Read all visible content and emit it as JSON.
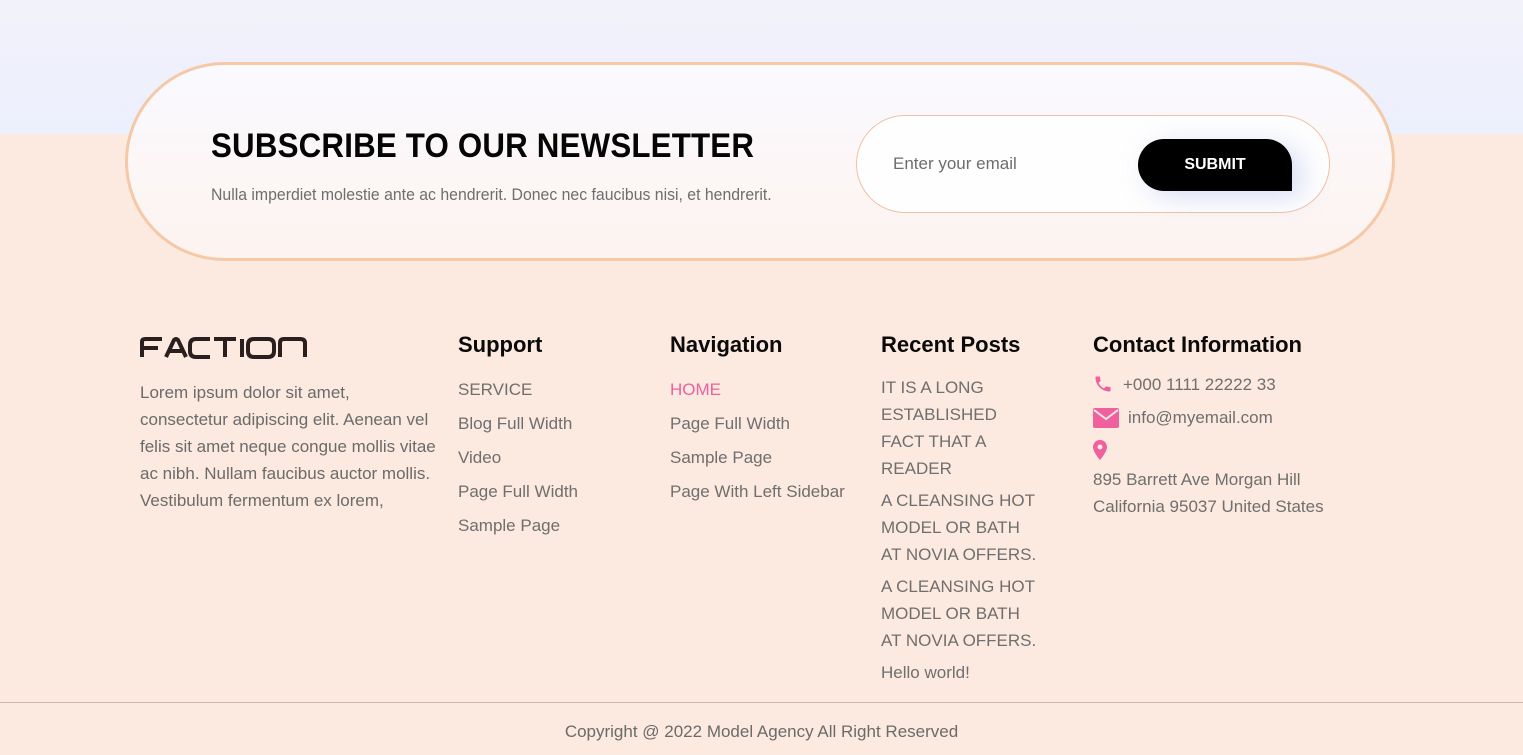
{
  "newsletter": {
    "title": "SUBSCRIBE TO OUR NEWSLETTER",
    "description": "Nulla imperdiet molestie ante ac hendrerit. Donec nec faucibus nisi, et hendrerit.",
    "email_placeholder": "Enter your email",
    "submit_label": "SUBMIT"
  },
  "brand": {
    "logo_text": "FACTION",
    "about": "Lorem ipsum dolor sit amet, consectetur adipiscing elit. Aenean vel felis sit amet neque congue mollis vitae ac nibh. Nullam faucibus auctor mollis. Vestibulum fermentum ex lorem,"
  },
  "support": {
    "heading": "Support",
    "items": [
      "SERVICE",
      "Blog Full Width",
      "Video",
      "Page Full Width",
      "Sample Page"
    ]
  },
  "navigation": {
    "heading": "Navigation",
    "items": [
      "HOME",
      "Page Full Width",
      "Sample Page",
      "Page With Left Sidebar"
    ]
  },
  "recent_posts": {
    "heading": "Recent Posts",
    "items": [
      "IT IS A LONG ESTABLISHED FACT THAT A READER",
      "A CLEANSING HOT MODEL OR BATH AT NOVIA OFFERS.",
      "A CLEANSING HOT MODEL OR BATH AT NOVIA OFFERS.",
      "Hello world!"
    ]
  },
  "contact": {
    "heading": "Contact Information",
    "phone": "+000 1111 22222 33",
    "email": "info@myemail.com",
    "address": "895 Barrett Ave Morgan Hill California 95037 United States"
  },
  "footer": {
    "copyright": "Copyright @ 2022 Model Agency All Right Reserved"
  },
  "colors": {
    "accent": "#f0609e",
    "background": "#fce9df",
    "border": "#f5c9a7",
    "button": "#000000"
  },
  "icons": {
    "phone": "phone-icon",
    "email": "envelope-icon",
    "location": "map-pin-icon"
  }
}
